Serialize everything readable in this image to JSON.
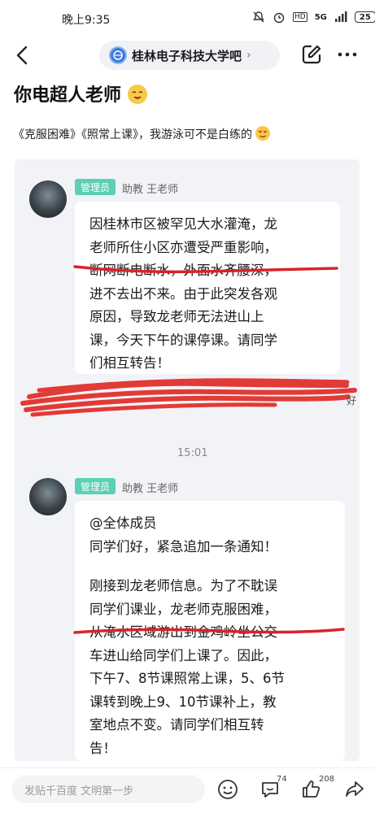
{
  "status_bar": {
    "time": "晚上9:35",
    "network": "5G",
    "battery": "25"
  },
  "nav": {
    "forum_name": "桂林电子科技大学吧",
    "forum_chevron": "›"
  },
  "post": {
    "title": "你电超人老师",
    "subtitle": "《克服困难》《照常上课》，我游泳可不是白练的"
  },
  "messages": [
    {
      "badge": "管理员",
      "sender": "助教 王老师",
      "lines": [
        "因桂林市区被罕见大水灌淹，龙",
        "老师所住小区亦遭受严重影响，",
        "断网断电断水，外面水齐腰深，",
        "进不去出不来。由于此突发各观",
        "原因，导致龙老师无法进山上",
        "课，今天下午的课停课。请同学",
        "们相互转告！"
      ]
    },
    {
      "badge": "管理员",
      "sender": "助教 王老师",
      "lines": [
        "@全体成员",
        "同学们好，紧急追加一条通知！",
        "",
        "刚接到龙老师信息。为了不耽误",
        "同学们课业，龙老师克服困难，",
        "从淹水区域游出到金鸡岭坐公交",
        "车进山给同学们上课了。因此，",
        "下午7、8节课照常上课，5、6节",
        "课转到晚上9、10节课补上，教",
        "室地点不变。请同学们相互转",
        "告！"
      ]
    }
  ],
  "timestamp": "15:01",
  "scribble_fragment": "好",
  "footer": {
    "reply_placeholder": "发贴千百度 文明第一步",
    "comment_count": "74",
    "like_count": "208"
  },
  "colors": {
    "admin_badge": "#5ccfb7",
    "underline_red": "#d8232a",
    "panel_bg": "#f2f3f6"
  },
  "icons": [
    "back-arrow-icon",
    "forum-logo-icon",
    "edit-icon",
    "more-icon",
    "emoji-icon",
    "comment-icon",
    "like-icon",
    "share-icon",
    "mute-icon",
    "alarm-icon",
    "signal-icon",
    "battery-icon"
  ]
}
